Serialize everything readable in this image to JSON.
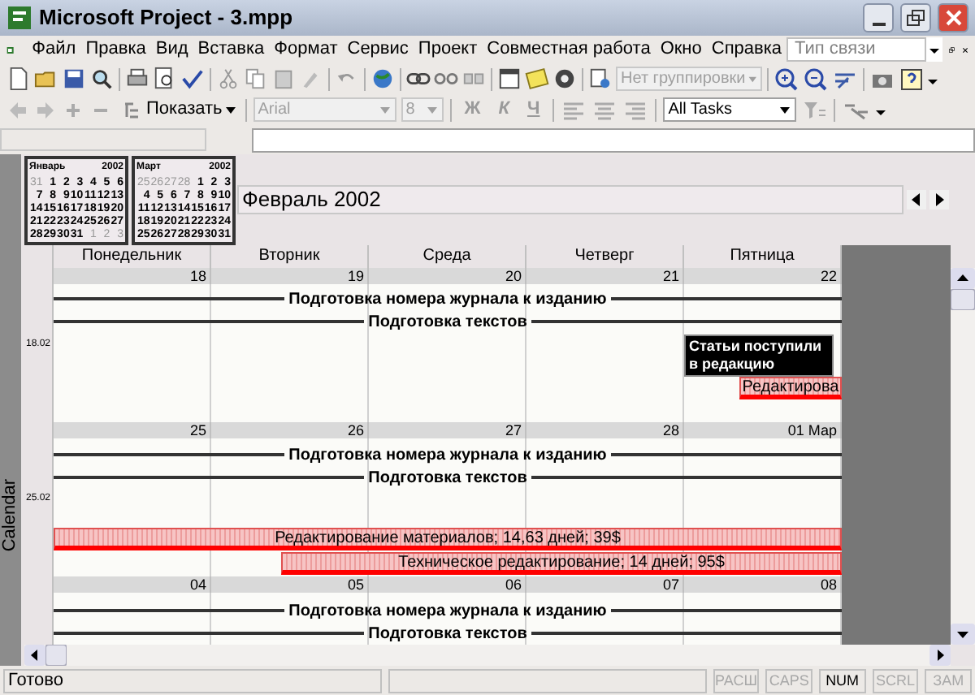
{
  "window": {
    "title": "Microsoft Project - 3.mpp"
  },
  "menu": [
    "Файл",
    "Правка",
    "Вид",
    "Вставка",
    "Формат",
    "Сервис",
    "Проект",
    "Совместная работа",
    "Окно",
    "Справка"
  ],
  "help_box": {
    "placeholder": "Тип связи"
  },
  "toolbar": {
    "group_combo": {
      "value": "Нет группировки",
      "disabled": true
    }
  },
  "format_bar": {
    "show_button": "Показать",
    "font_combo": {
      "value": "Arial",
      "disabled": true
    },
    "size_combo": {
      "value": "8",
      "disabled": true
    },
    "bold": "Ж",
    "italic": "К",
    "underline": "Ч",
    "filter_combo": {
      "value": "All Tasks",
      "disabled": false
    }
  },
  "view_bar": {
    "label": "Calendar"
  },
  "mini_calendars": [
    {
      "month": "Январь",
      "year": "2002",
      "rows": [
        [
          {
            "d": "31",
            "muted": true
          },
          {
            "d": "1",
            "muted": false
          },
          {
            "d": "2",
            "muted": false
          },
          {
            "d": "3",
            "muted": false
          },
          {
            "d": "4",
            "muted": false
          },
          {
            "d": "5",
            "muted": false
          },
          {
            "d": "6",
            "muted": false
          }
        ],
        [
          {
            "d": "7",
            "muted": false
          },
          {
            "d": "8",
            "muted": false
          },
          {
            "d": "9",
            "muted": false
          },
          {
            "d": "10",
            "muted": false
          },
          {
            "d": "11",
            "muted": false
          },
          {
            "d": "12",
            "muted": false
          },
          {
            "d": "13",
            "muted": false
          }
        ],
        [
          {
            "d": "14",
            "muted": false
          },
          {
            "d": "15",
            "muted": false
          },
          {
            "d": "16",
            "muted": false
          },
          {
            "d": "17",
            "muted": false
          },
          {
            "d": "18",
            "muted": false
          },
          {
            "d": "19",
            "muted": false
          },
          {
            "d": "20",
            "muted": false
          }
        ],
        [
          {
            "d": "21",
            "muted": false
          },
          {
            "d": "22",
            "muted": false
          },
          {
            "d": "23",
            "muted": false
          },
          {
            "d": "24",
            "muted": false
          },
          {
            "d": "25",
            "muted": false
          },
          {
            "d": "26",
            "muted": false
          },
          {
            "d": "27",
            "muted": false
          }
        ],
        [
          {
            "d": "28",
            "muted": false
          },
          {
            "d": "29",
            "muted": false
          },
          {
            "d": "30",
            "muted": false
          },
          {
            "d": "31",
            "muted": false
          },
          {
            "d": "1",
            "muted": true
          },
          {
            "d": "2",
            "muted": true
          },
          {
            "d": "3",
            "muted": true
          }
        ]
      ]
    },
    {
      "month": "Март",
      "year": "2002",
      "rows": [
        [
          {
            "d": "25",
            "muted": true
          },
          {
            "d": "26",
            "muted": true
          },
          {
            "d": "27",
            "muted": true
          },
          {
            "d": "28",
            "muted": true
          },
          {
            "d": "1",
            "muted": false
          },
          {
            "d": "2",
            "muted": false
          },
          {
            "d": "3",
            "muted": false
          }
        ],
        [
          {
            "d": "4",
            "muted": false
          },
          {
            "d": "5",
            "muted": false
          },
          {
            "d": "6",
            "muted": false
          },
          {
            "d": "7",
            "muted": false
          },
          {
            "d": "8",
            "muted": false
          },
          {
            "d": "9",
            "muted": false
          },
          {
            "d": "10",
            "muted": false
          }
        ],
        [
          {
            "d": "11",
            "muted": false
          },
          {
            "d": "12",
            "muted": false
          },
          {
            "d": "13",
            "muted": false
          },
          {
            "d": "14",
            "muted": false
          },
          {
            "d": "15",
            "muted": false
          },
          {
            "d": "16",
            "muted": false
          },
          {
            "d": "17",
            "muted": false
          }
        ],
        [
          {
            "d": "18",
            "muted": false
          },
          {
            "d": "19",
            "muted": false
          },
          {
            "d": "20",
            "muted": false
          },
          {
            "d": "21",
            "muted": false
          },
          {
            "d": "22",
            "muted": false
          },
          {
            "d": "23",
            "muted": false
          },
          {
            "d": "24",
            "muted": false
          }
        ],
        [
          {
            "d": "25",
            "muted": false
          },
          {
            "d": "26",
            "muted": false
          },
          {
            "d": "27",
            "muted": false
          },
          {
            "d": "28",
            "muted": false
          },
          {
            "d": "29",
            "muted": false
          },
          {
            "d": "30",
            "muted": false
          },
          {
            "d": "31",
            "muted": false
          }
        ]
      ]
    }
  ],
  "calendar": {
    "title": "Февраль 2002",
    "weekdays": [
      "Понедельник",
      "Вторник",
      "Среда",
      "Четверг",
      "Пятница"
    ],
    "weeks": [
      {
        "label": "18.02",
        "days": [
          "18",
          "19",
          "20",
          "21",
          "22"
        ],
        "bars": [
          {
            "kind": "summary",
            "label": "Подготовка номера журнала к изданию"
          },
          {
            "kind": "summary",
            "label": "Подготовка текстов"
          },
          {
            "kind": "milestone",
            "label": "Статьи поступили в редакцию"
          },
          {
            "kind": "task",
            "label": "Редактирова"
          }
        ]
      },
      {
        "label": "25.02",
        "days": [
          "25",
          "26",
          "27",
          "28",
          "01 Мар"
        ],
        "bars": [
          {
            "kind": "summary",
            "label": "Подготовка номера журнала к изданию"
          },
          {
            "kind": "summary",
            "label": "Подготовка текстов"
          },
          {
            "kind": "task",
            "label": "Редактирование материалов; 14,63 дней; 39$"
          },
          {
            "kind": "task",
            "label": "Техническое редактирование; 14 дней; 95$"
          }
        ]
      },
      {
        "days": [
          "04",
          "05",
          "06",
          "07",
          "08"
        ],
        "bars": [
          {
            "kind": "summary",
            "label": "Подготовка номера журнала к изданию"
          },
          {
            "kind": "summary",
            "label": "Подготовка текстов"
          }
        ]
      }
    ]
  },
  "status_bar": {
    "text": "Готово",
    "indicators": [
      {
        "label": "РАСШ",
        "on": false
      },
      {
        "label": "CAPS",
        "on": false
      },
      {
        "label": "NUM",
        "on": true
      },
      {
        "label": "SCRL",
        "on": false
      },
      {
        "label": "ЗАМ",
        "on": false
      }
    ]
  }
}
